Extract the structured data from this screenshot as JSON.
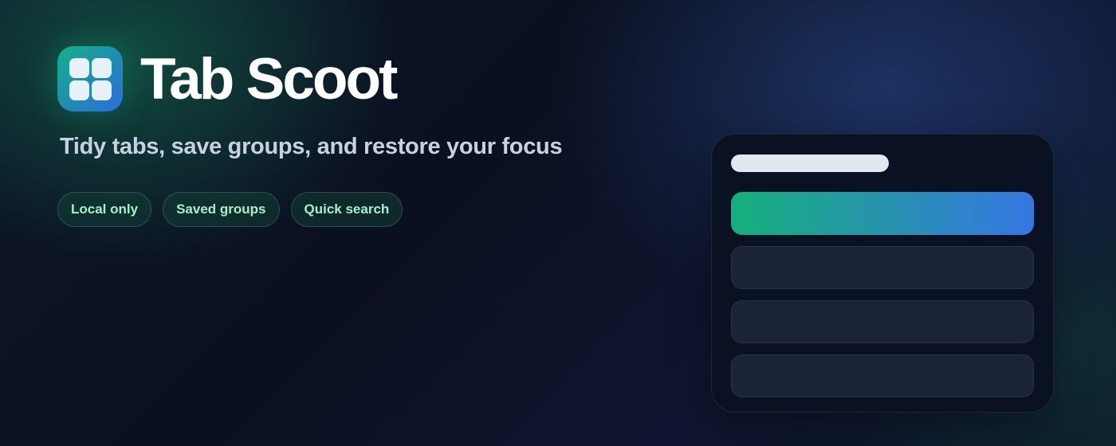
{
  "app": {
    "title": "Tab Scoot",
    "tagline": "Tidy tabs, save groups, and restore your focus",
    "logo_icon": "grid-four-squares-icon"
  },
  "features": [
    {
      "label": "Local only"
    },
    {
      "label": "Saved groups"
    },
    {
      "label": "Quick search"
    }
  ],
  "preview": {
    "rows": [
      {
        "state": "active"
      },
      {
        "state": "inactive"
      },
      {
        "state": "inactive"
      },
      {
        "state": "inactive"
      }
    ]
  },
  "colors": {
    "accent_start": "#14b07c",
    "accent_end": "#3677e4",
    "pill_text": "#a7f0c4",
    "background": "#0b1020"
  }
}
